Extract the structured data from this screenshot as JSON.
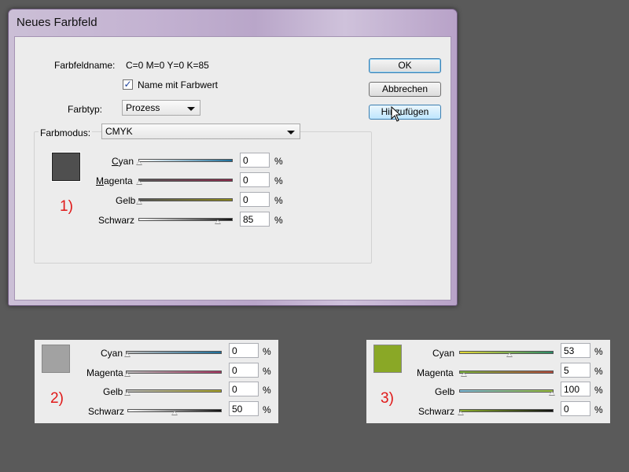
{
  "dialog": {
    "title": "Neues Farbfeld",
    "swatch_name_label": "Farbfeldname:",
    "swatch_name_value": "C=0 M=0 Y=0 K=85",
    "name_with_value_label": "Name mit Farbwert",
    "name_with_value_checked": true,
    "color_type_label": "Farbtyp:",
    "color_type_value": "Prozess",
    "color_mode_label": "Farbmodus:",
    "color_mode_value": "CMYK",
    "buttons": {
      "ok": "OK",
      "cancel": "Abbrechen",
      "add": "Hinzufügen"
    },
    "swatch_color": "#4f4f4f",
    "annotation": "1)",
    "channels": [
      {
        "name": "Cyan",
        "value": "0"
      },
      {
        "name": "Magenta",
        "value": "0"
      },
      {
        "name": "Gelb",
        "value": "0"
      },
      {
        "name": "Schwarz",
        "value": "85"
      }
    ]
  },
  "panel2": {
    "annotation": "2)",
    "swatch_color": "#a2a2a2",
    "channels": [
      {
        "name": "Cyan",
        "value": "0"
      },
      {
        "name": "Magenta",
        "value": "0"
      },
      {
        "name": "Gelb",
        "value": "0"
      },
      {
        "name": "Schwarz",
        "value": "50"
      }
    ]
  },
  "panel3": {
    "annotation": "3)",
    "swatch_color": "#8aa826",
    "channels": [
      {
        "name": "Cyan",
        "value": "53"
      },
      {
        "name": "Magenta",
        "value": "5"
      },
      {
        "name": "Gelb",
        "value": "100"
      },
      {
        "name": "Schwarz",
        "value": "0"
      }
    ]
  },
  "percent_sign": "%"
}
